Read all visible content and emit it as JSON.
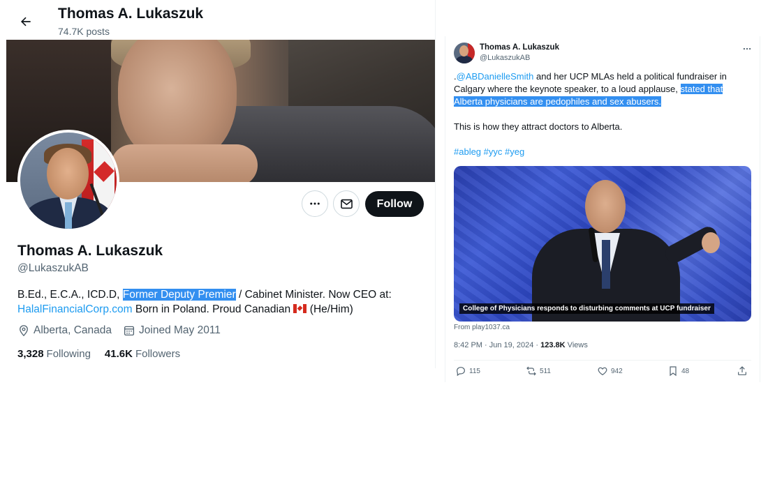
{
  "profile": {
    "top_name": "Thomas A. Lukaszuk",
    "posts_count": "74.7K posts",
    "name": "Thomas A. Lukaszuk",
    "handle": "@LukaszukAB",
    "follow_label": "Follow",
    "bio": {
      "part1": "B.Ed., E.C.A., ICD.D, ",
      "highlight": "Former Deputy Premier",
      "part2": " / Cabinet Minister. Now CEO at:",
      "link": "HalalFinancialCorp.com",
      "part3": " Born in Poland. Proud Canadian ",
      "part4": " (He/Him)"
    },
    "location": "Alberta, Canada",
    "joined": "Joined May 2011",
    "following_count": "3,328",
    "following_label": "Following",
    "followers_count": "41.6K",
    "followers_label": "Followers"
  },
  "tweet": {
    "author_name": "Thomas A. Lukaszuk",
    "author_handle": "@LukaszukAB",
    "text": {
      "prefix": ".",
      "mention": "@ABDanielleSmith",
      "body": " and her UCP MLAs held a political fundraiser in Calgary where the keynote speaker, to a loud applause, ",
      "highlight": "stated that Alberta physicians are pedophiles and sex abusers.",
      "para2": "This is how they attract doctors to Alberta.",
      "hashtags": "#ableg #yyc #yeg"
    },
    "media_caption": "College of Physicians responds to disturbing comments at UCP fundraiser",
    "media_source": "From play1037.ca",
    "timestamp": "8:42 PM · Jun 19, 2024 · ",
    "views_count": "123.8K",
    "views_label": " Views",
    "replies": "115",
    "reposts": "511",
    "likes": "942",
    "bookmarks": "48"
  },
  "icons": [
    "back-arrow-icon",
    "more-icon",
    "mail-icon",
    "location-icon",
    "calendar-icon",
    "reply-icon",
    "repost-icon",
    "like-icon",
    "bookmark-icon",
    "share-icon"
  ],
  "colors": {
    "link": "#1d9bf0",
    "highlight": "#338ff0",
    "follow_bg": "#0f1419",
    "muted": "#536471"
  }
}
